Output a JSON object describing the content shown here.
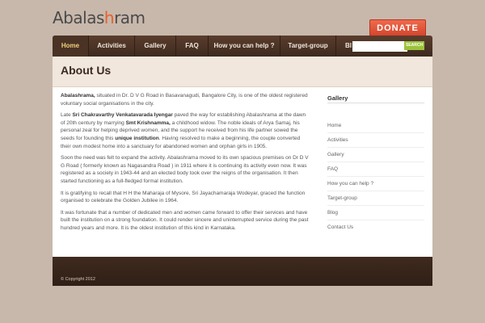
{
  "logo": {
    "text_before": "Abalas",
    "text_accent": "h",
    "text_after": "ram"
  },
  "donate_label": "DONATE",
  "nav": {
    "items": [
      {
        "label": "Home"
      },
      {
        "label": "Activities"
      },
      {
        "label": "Gallery"
      },
      {
        "label": "FAQ"
      },
      {
        "label": "How you can help ?"
      },
      {
        "label": "Target-group"
      },
      {
        "label": "Bl"
      }
    ],
    "active": "Home"
  },
  "search": {
    "button_label": "SEARCH",
    "placeholder": ""
  },
  "page_title": "About Us",
  "content": {
    "p1": {
      "bold": "Abalashrama,",
      "text": " situated in Dr. D V G Road in Basavanagudi, Bangalore City, is one of the oldest registered voluntary social organisations in the city."
    },
    "p2": {
      "t1": "Late ",
      "b1": "Sri Chakravarthy Venkatavarada Iyengar",
      "t2": " paved the way for establishing Abalashrama at the dawn of 20th century by marrying ",
      "b2": "Smt Krishnamma,",
      "t3": " a childhood widow. The noble ideals of Arya Samaj, his personal zeal for helping deprived women, and the support he received from his life partner sowed the seeds for founding this ",
      "b3": "unique institution",
      "t4": ". Having resolved to make a beginning, the couple converted their own modest home into a sanctuary for abandoned women and orphan girls in 1905."
    },
    "p3": "Soon the need was felt to expand the activity. Abalashrama moved to its own spacious premises on Dr D V G Road ( formerly known as Nagasandra Road ) in 1911 where it is continuing  its activity even now. It was registered as a society in 1943-44 and an elected body took over the reigns of the organisation. It then started functioning as a full-fledged formal institution.",
    "p4": "It is gratifying to recall that H H the Maharaja of Mysore, Sri Jayachamaraja Wodeyar, graced the function organised to celebrate the Golden Jubilee in 1964.",
    "p5": "It was fortunate that a number of dedicated men and women came forward to offer their services and have built the institution on a strong foundation. It could render sincere and uninterrupted service during the past hundred years and more. It is the oldest institution of this kind in Karnataka."
  },
  "sidebar": {
    "title": "Gallery",
    "links": [
      {
        "label": "Home"
      },
      {
        "label": "Activities"
      },
      {
        "label": "Gallery"
      },
      {
        "label": "FAQ"
      },
      {
        "label": "How you can help ?"
      },
      {
        "label": "Target-group"
      },
      {
        "label": "Blog"
      },
      {
        "label": "Contact Us"
      }
    ]
  },
  "footer": {
    "copyright": "© Copyright 2012"
  },
  "colors": {
    "background": "#c8b8ab",
    "nav": "#4a3225",
    "nav_active_text": "#f1d17a",
    "donate": "#e0543a",
    "search_button": "#9bc23a",
    "footer": "#3a271c"
  }
}
